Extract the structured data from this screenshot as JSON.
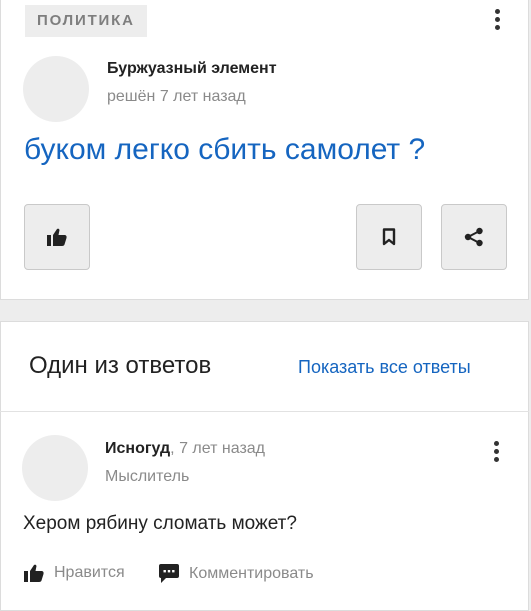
{
  "question": {
    "category": "ПОЛИТИКА",
    "author": "Буржуазный элемент",
    "status": "решён 7 лет назад",
    "title": "буком легко сбить самолет ?"
  },
  "answers_section": {
    "title": "Один из ответов",
    "show_all_label": "Показать все ответы"
  },
  "answer": {
    "author": "Исногуд",
    "separator": ",",
    "time": "7 лет назад",
    "rank": "Мыслитель",
    "text": "Хером рябину сломать может?",
    "like_label": "Нравится",
    "comment_label": "Комментировать"
  },
  "colors": {
    "accent": "#1565c0",
    "muted_text": "#8a8a8a",
    "panel_bg": "#ededed"
  },
  "icons": [
    "more-vertical-icon",
    "thumbs-up-icon",
    "bookmark-icon",
    "share-icon",
    "comment-icon"
  ]
}
